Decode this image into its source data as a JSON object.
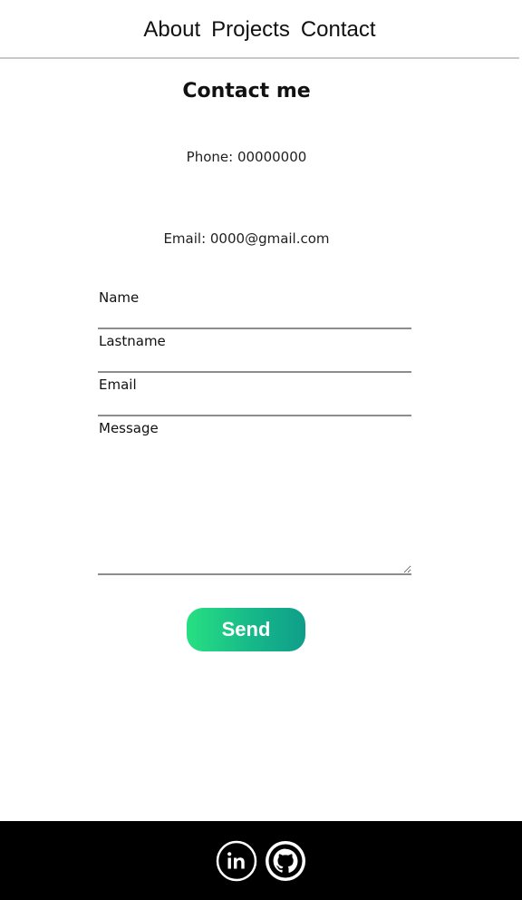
{
  "nav": {
    "about": "About",
    "projects": "Projects",
    "contact": "Contact"
  },
  "title": "Contact me",
  "phone": "Phone: 00000000",
  "email": "Email: 0000@gmail.com",
  "form": {
    "name_label": "Name",
    "lastname_label": "Lastname",
    "email_label": "Email",
    "message_label": "Message",
    "send_label": "Send"
  },
  "footer": {
    "icons": [
      "linkedin-icon",
      "github-icon"
    ]
  },
  "colors": {
    "button_start": "#27e082",
    "button_end": "#0f9e8a",
    "footer_bg": "#000000"
  }
}
